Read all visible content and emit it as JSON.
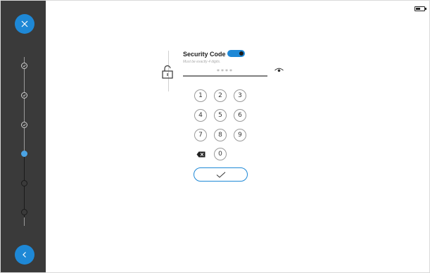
{
  "sidebar": {
    "close_button_icon": "close-icon",
    "back_button_icon": "chevron-left-icon",
    "accent_color": "#1e88d6",
    "steps": [
      {
        "state": "done"
      },
      {
        "state": "done"
      },
      {
        "state": "done"
      },
      {
        "state": "current"
      },
      {
        "state": "pending"
      },
      {
        "state": "pending"
      }
    ]
  },
  "status_bar": {
    "battery_icon": "battery-icon"
  },
  "security": {
    "title": "Security Code",
    "toggle_on": true,
    "hint": "Must be exactly 4 digits.",
    "code_placeholder": "****",
    "lock_icon": "unlocked-padlock-icon",
    "reveal_icon": "eye-icon"
  },
  "keypad": {
    "keys": [
      "1",
      "2",
      "3",
      "4",
      "5",
      "6",
      "7",
      "8",
      "9",
      "0"
    ],
    "backspace_icon": "backspace-icon",
    "confirm_icon": "checkmark-icon"
  }
}
